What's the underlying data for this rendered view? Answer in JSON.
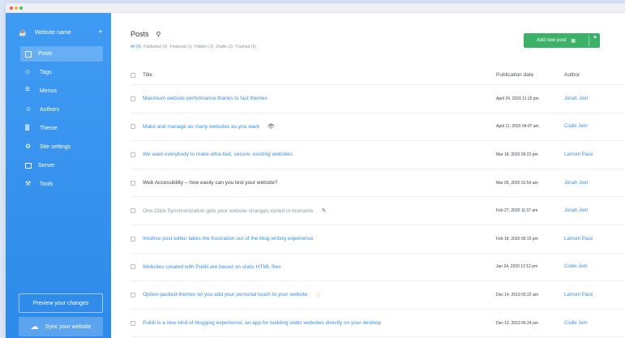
{
  "sidebar": {
    "site_name": "Website name",
    "nav": [
      {
        "label": "Posts",
        "icon": "posts-icon",
        "active": true
      },
      {
        "label": "Tags",
        "icon": "tag-icon"
      },
      {
        "label": "Menus",
        "icon": "menu-icon"
      },
      {
        "label": "Authors",
        "icon": "authors-icon"
      },
      {
        "label": "Theme",
        "icon": "theme-icon"
      },
      {
        "label": "Site settings",
        "icon": "settings-icon"
      },
      {
        "label": "Server",
        "icon": "server-icon"
      },
      {
        "label": "Tools",
        "icon": "tools-icon"
      }
    ],
    "preview_label": "Preview your changes",
    "sync_label": "Sync your website"
  },
  "main": {
    "title": "Posts",
    "add_button_label": "Add new post",
    "filters": [
      "All (9)",
      "Published (6)",
      "Featured (1)",
      "Hidden (2)",
      "Drafts (3)",
      "Trashed (3)"
    ],
    "columns": {
      "title": "Title",
      "date": "Publication date",
      "author": "Author"
    },
    "rows": [
      {
        "title": "Maximum website performance thanks to fast themes",
        "date": "April 24, 2020 11:15 pm",
        "author": "Jonah Joel",
        "status": "published"
      },
      {
        "title": "Make and manage as many websites as you want",
        "date": "April 11, 2020 04:07 am",
        "author": "Codie Jem",
        "status": "hidden",
        "icon": "eye-icon"
      },
      {
        "title": "We want everybody to make ultra-fast, secure, exciting websites",
        "date": "Mar 18, 2020 06:22 pm",
        "author": "Lamont Pace",
        "status": "published"
      },
      {
        "title": "Web Accessibility – how easily can you test your website?",
        "date": "Mar 05, 2020 01:56 am",
        "author": "Jonah Joel",
        "status": "plain"
      },
      {
        "title": "One-Click Synchronization gets your website changes sorted in moments",
        "date": "Feb 27, 2020 11:37 am",
        "author": "Jonah Joel",
        "status": "draft",
        "icon": "pencil-icon"
      },
      {
        "title": "Intuitive post editor takes the frustration out of the blog writing experience",
        "date": "Feb 18, 2020 05:15 pm",
        "author": "Lamont Pace",
        "status": "published"
      },
      {
        "title": "Websites created with Publii are based on static HTML files",
        "date": "Jan 24, 2020 12:12 pm",
        "author": "Codie Jem",
        "status": "published"
      },
      {
        "title": "Option-packed themes let you add your personal touch to your website",
        "date": "Dec 14, 2019 02:22 am",
        "author": "Lamont Pace",
        "status": "featured",
        "icon": "star-icon"
      },
      {
        "title": "Publii is a new kind of blogging experience; an app for building static websites directly on your desktop",
        "date": "Dec 12, 2019 06:24 pm",
        "author": "Codie Jem",
        "status": "published"
      }
    ]
  },
  "colors": {
    "sidebar": "#3a95ef",
    "accent": "#3c8fe6",
    "add_button": "#3cb168",
    "featured_star": "#f0b400"
  }
}
